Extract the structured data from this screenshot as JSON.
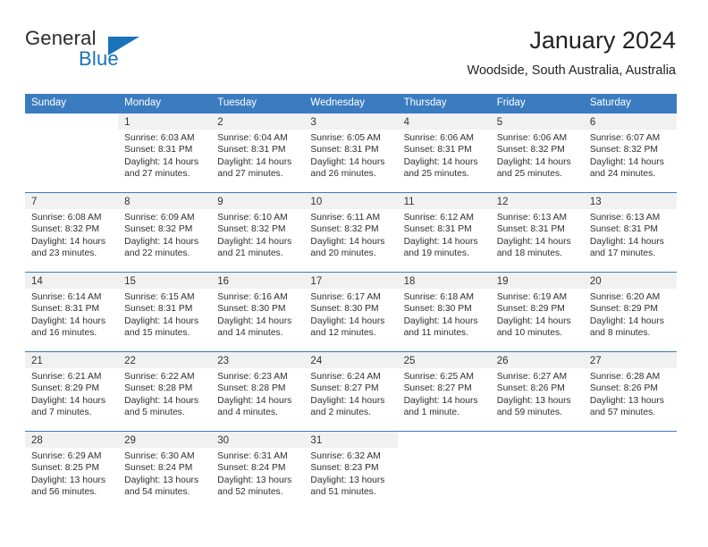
{
  "brand": {
    "word_one": "General",
    "word_two": "Blue",
    "icon": "triangle-logo-icon"
  },
  "header": {
    "title": "January 2024",
    "subtitle": "Woodside, South Australia, Australia"
  },
  "calendar": {
    "weekdays": [
      "Sunday",
      "Monday",
      "Tuesday",
      "Wednesday",
      "Thursday",
      "Friday",
      "Saturday"
    ],
    "accent_color": "#3b7cc0",
    "day_band_color": "#f1f1f1",
    "labels": {
      "sunrise": "Sunrise:",
      "sunset": "Sunset:",
      "daylight": "Daylight:"
    },
    "weeks": [
      [
        {
          "day": "",
          "sunrise": "",
          "sunset": "",
          "daylight_a": "",
          "daylight_b": ""
        },
        {
          "day": "1",
          "sunrise": "Sunrise: 6:03 AM",
          "sunset": "Sunset: 8:31 PM",
          "daylight_a": "Daylight: 14 hours",
          "daylight_b": "and 27 minutes."
        },
        {
          "day": "2",
          "sunrise": "Sunrise: 6:04 AM",
          "sunset": "Sunset: 8:31 PM",
          "daylight_a": "Daylight: 14 hours",
          "daylight_b": "and 27 minutes."
        },
        {
          "day": "3",
          "sunrise": "Sunrise: 6:05 AM",
          "sunset": "Sunset: 8:31 PM",
          "daylight_a": "Daylight: 14 hours",
          "daylight_b": "and 26 minutes."
        },
        {
          "day": "4",
          "sunrise": "Sunrise: 6:06 AM",
          "sunset": "Sunset: 8:31 PM",
          "daylight_a": "Daylight: 14 hours",
          "daylight_b": "and 25 minutes."
        },
        {
          "day": "5",
          "sunrise": "Sunrise: 6:06 AM",
          "sunset": "Sunset: 8:32 PM",
          "daylight_a": "Daylight: 14 hours",
          "daylight_b": "and 25 minutes."
        },
        {
          "day": "6",
          "sunrise": "Sunrise: 6:07 AM",
          "sunset": "Sunset: 8:32 PM",
          "daylight_a": "Daylight: 14 hours",
          "daylight_b": "and 24 minutes."
        }
      ],
      [
        {
          "day": "7",
          "sunrise": "Sunrise: 6:08 AM",
          "sunset": "Sunset: 8:32 PM",
          "daylight_a": "Daylight: 14 hours",
          "daylight_b": "and 23 minutes."
        },
        {
          "day": "8",
          "sunrise": "Sunrise: 6:09 AM",
          "sunset": "Sunset: 8:32 PM",
          "daylight_a": "Daylight: 14 hours",
          "daylight_b": "and 22 minutes."
        },
        {
          "day": "9",
          "sunrise": "Sunrise: 6:10 AM",
          "sunset": "Sunset: 8:32 PM",
          "daylight_a": "Daylight: 14 hours",
          "daylight_b": "and 21 minutes."
        },
        {
          "day": "10",
          "sunrise": "Sunrise: 6:11 AM",
          "sunset": "Sunset: 8:32 PM",
          "daylight_a": "Daylight: 14 hours",
          "daylight_b": "and 20 minutes."
        },
        {
          "day": "11",
          "sunrise": "Sunrise: 6:12 AM",
          "sunset": "Sunset: 8:31 PM",
          "daylight_a": "Daylight: 14 hours",
          "daylight_b": "and 19 minutes."
        },
        {
          "day": "12",
          "sunrise": "Sunrise: 6:13 AM",
          "sunset": "Sunset: 8:31 PM",
          "daylight_a": "Daylight: 14 hours",
          "daylight_b": "and 18 minutes."
        },
        {
          "day": "13",
          "sunrise": "Sunrise: 6:13 AM",
          "sunset": "Sunset: 8:31 PM",
          "daylight_a": "Daylight: 14 hours",
          "daylight_b": "and 17 minutes."
        }
      ],
      [
        {
          "day": "14",
          "sunrise": "Sunrise: 6:14 AM",
          "sunset": "Sunset: 8:31 PM",
          "daylight_a": "Daylight: 14 hours",
          "daylight_b": "and 16 minutes."
        },
        {
          "day": "15",
          "sunrise": "Sunrise: 6:15 AM",
          "sunset": "Sunset: 8:31 PM",
          "daylight_a": "Daylight: 14 hours",
          "daylight_b": "and 15 minutes."
        },
        {
          "day": "16",
          "sunrise": "Sunrise: 6:16 AM",
          "sunset": "Sunset: 8:30 PM",
          "daylight_a": "Daylight: 14 hours",
          "daylight_b": "and 14 minutes."
        },
        {
          "day": "17",
          "sunrise": "Sunrise: 6:17 AM",
          "sunset": "Sunset: 8:30 PM",
          "daylight_a": "Daylight: 14 hours",
          "daylight_b": "and 12 minutes."
        },
        {
          "day": "18",
          "sunrise": "Sunrise: 6:18 AM",
          "sunset": "Sunset: 8:30 PM",
          "daylight_a": "Daylight: 14 hours",
          "daylight_b": "and 11 minutes."
        },
        {
          "day": "19",
          "sunrise": "Sunrise: 6:19 AM",
          "sunset": "Sunset: 8:29 PM",
          "daylight_a": "Daylight: 14 hours",
          "daylight_b": "and 10 minutes."
        },
        {
          "day": "20",
          "sunrise": "Sunrise: 6:20 AM",
          "sunset": "Sunset: 8:29 PM",
          "daylight_a": "Daylight: 14 hours",
          "daylight_b": "and 8 minutes."
        }
      ],
      [
        {
          "day": "21",
          "sunrise": "Sunrise: 6:21 AM",
          "sunset": "Sunset: 8:29 PM",
          "daylight_a": "Daylight: 14 hours",
          "daylight_b": "and 7 minutes."
        },
        {
          "day": "22",
          "sunrise": "Sunrise: 6:22 AM",
          "sunset": "Sunset: 8:28 PM",
          "daylight_a": "Daylight: 14 hours",
          "daylight_b": "and 5 minutes."
        },
        {
          "day": "23",
          "sunrise": "Sunrise: 6:23 AM",
          "sunset": "Sunset: 8:28 PM",
          "daylight_a": "Daylight: 14 hours",
          "daylight_b": "and 4 minutes."
        },
        {
          "day": "24",
          "sunrise": "Sunrise: 6:24 AM",
          "sunset": "Sunset: 8:27 PM",
          "daylight_a": "Daylight: 14 hours",
          "daylight_b": "and 2 minutes."
        },
        {
          "day": "25",
          "sunrise": "Sunrise: 6:25 AM",
          "sunset": "Sunset: 8:27 PM",
          "daylight_a": "Daylight: 14 hours",
          "daylight_b": "and 1 minute."
        },
        {
          "day": "26",
          "sunrise": "Sunrise: 6:27 AM",
          "sunset": "Sunset: 8:26 PM",
          "daylight_a": "Daylight: 13 hours",
          "daylight_b": "and 59 minutes."
        },
        {
          "day": "27",
          "sunrise": "Sunrise: 6:28 AM",
          "sunset": "Sunset: 8:26 PM",
          "daylight_a": "Daylight: 13 hours",
          "daylight_b": "and 57 minutes."
        }
      ],
      [
        {
          "day": "28",
          "sunrise": "Sunrise: 6:29 AM",
          "sunset": "Sunset: 8:25 PM",
          "daylight_a": "Daylight: 13 hours",
          "daylight_b": "and 56 minutes."
        },
        {
          "day": "29",
          "sunrise": "Sunrise: 6:30 AM",
          "sunset": "Sunset: 8:24 PM",
          "daylight_a": "Daylight: 13 hours",
          "daylight_b": "and 54 minutes."
        },
        {
          "day": "30",
          "sunrise": "Sunrise: 6:31 AM",
          "sunset": "Sunset: 8:24 PM",
          "daylight_a": "Daylight: 13 hours",
          "daylight_b": "and 52 minutes."
        },
        {
          "day": "31",
          "sunrise": "Sunrise: 6:32 AM",
          "sunset": "Sunset: 8:23 PM",
          "daylight_a": "Daylight: 13 hours",
          "daylight_b": "and 51 minutes."
        },
        {
          "day": "",
          "sunrise": "",
          "sunset": "",
          "daylight_a": "",
          "daylight_b": ""
        },
        {
          "day": "",
          "sunrise": "",
          "sunset": "",
          "daylight_a": "",
          "daylight_b": ""
        },
        {
          "day": "",
          "sunrise": "",
          "sunset": "",
          "daylight_a": "",
          "daylight_b": ""
        }
      ]
    ]
  }
}
